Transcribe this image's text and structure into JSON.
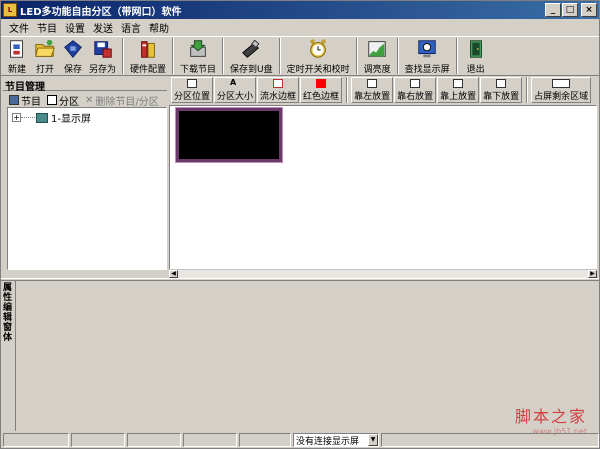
{
  "window": {
    "title": "LED多功能自由分区（带网口）软件",
    "minimize": "_",
    "maximize": "□",
    "close": "×"
  },
  "menu": [
    "文件",
    "节目",
    "设置",
    "发送",
    "语言",
    "帮助"
  ],
  "toolbar": [
    {
      "id": "new",
      "label": "新建",
      "icon": "new-file-icon"
    },
    {
      "id": "open",
      "label": "打开",
      "icon": "folder-open-icon"
    },
    {
      "id": "save",
      "label": "保存",
      "icon": "save-icon"
    },
    {
      "id": "saveas",
      "label": "另存为",
      "icon": "save-as-icon"
    },
    {
      "id": "hwconfig",
      "label": "硬件配置",
      "icon": "hardware-icon"
    },
    {
      "id": "download",
      "label": "下载节目",
      "icon": "download-icon"
    },
    {
      "id": "saveu",
      "label": "保存到U盘",
      "icon": "usb-drive-icon"
    },
    {
      "id": "timer",
      "label": "定时开关和校时",
      "icon": "alarm-clock-icon"
    },
    {
      "id": "brightness",
      "label": "调亮度",
      "icon": "brightness-chart-icon"
    },
    {
      "id": "findscreen",
      "label": "查找显示屏",
      "icon": "find-screen-icon"
    },
    {
      "id": "exit",
      "label": "退出",
      "icon": "exit-door-icon"
    }
  ],
  "left_panel": {
    "title": "节目管理",
    "program_btn": "节目",
    "partition_btn": "分区",
    "delete_btn": "删除节目/分区",
    "tree_item": "1-显示屏"
  },
  "right_toolbar": [
    {
      "id": "pos",
      "label": "分区位置"
    },
    {
      "id": "size",
      "label": "分区大小"
    },
    {
      "id": "flow",
      "label": "流水边框"
    },
    {
      "id": "red",
      "label": "红色边框"
    },
    {
      "id": "left",
      "label": "靠左放置"
    },
    {
      "id": "right",
      "label": "靠右放置"
    },
    {
      "id": "top",
      "label": "靠上放置"
    },
    {
      "id": "bottom",
      "label": "靠下放置"
    },
    {
      "id": "fill",
      "label": "占屏剩余区域"
    }
  ],
  "property_tab": "属性编辑窗体",
  "statusbar": {
    "connection": "没有连接显示屏"
  },
  "watermark": {
    "main": "脚本之家",
    "url": "www.jb51.net"
  },
  "colors": {
    "titlebar": "#0a246a",
    "led_screen": "#000000",
    "led_border": "#6a3a6a"
  }
}
